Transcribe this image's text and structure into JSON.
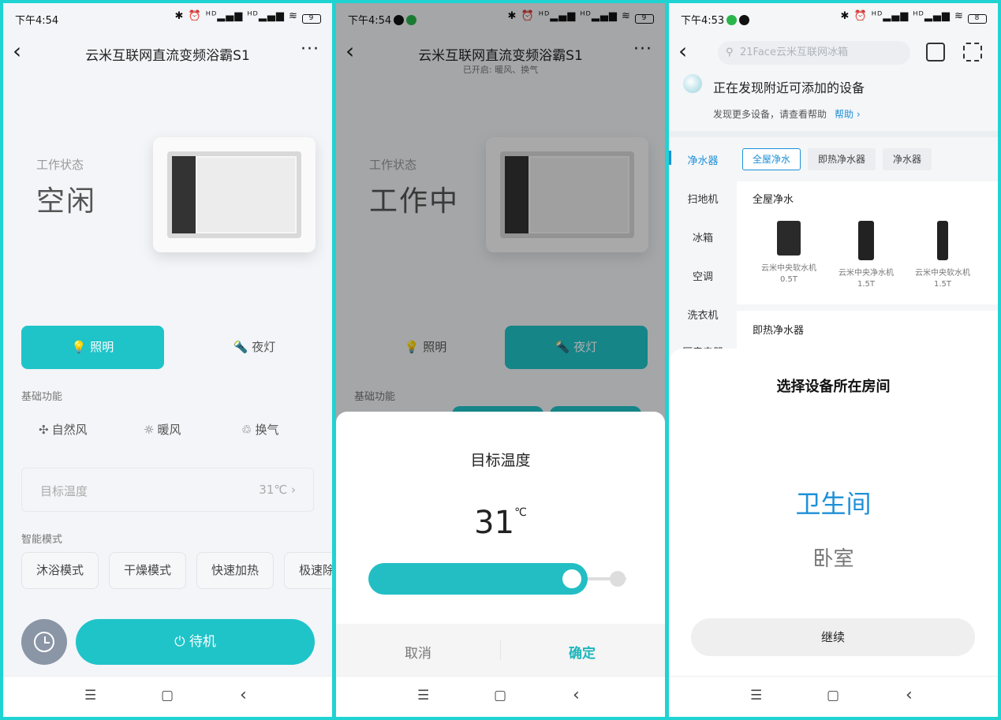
{
  "screen1": {
    "status": {
      "time": "下午4:54",
      "right": "✱ ⏰ ᴴᴰ▂▄▆ ᴴᴰ▂▄▆ ≋",
      "battery": "9"
    },
    "nav": {
      "title": "云米互联网直流变频浴霸S1",
      "more": "···"
    },
    "work_state_label": "工作状态",
    "work_state_value": "空闲",
    "tabs": [
      {
        "label": "照明",
        "active": true
      },
      {
        "label": "夜灯",
        "active": false
      }
    ],
    "basic_label": "基础功能",
    "functions": [
      "自然风",
      "暖风",
      "换气"
    ],
    "target_temp": {
      "label": "目标温度",
      "value": "31℃"
    },
    "smart_label": "智能模式",
    "modes": [
      "沐浴模式",
      "干燥模式",
      "快速加热",
      "极速除"
    ],
    "standby_label": "待机"
  },
  "screen2": {
    "status": {
      "time": "下午4:54",
      "right": "✱ ⏰ ᴴᴰ▂▄▆ ᴴᴰ▂▄▆ ≋",
      "battery": "9"
    },
    "nav": {
      "title": "云米互联网直流变频浴霸S1",
      "subtitle": "已开启: 暖风、换气",
      "more": "···"
    },
    "work_state_label": "工作状态",
    "work_state_value": "工作中",
    "tabs": [
      {
        "label": "照明",
        "active": false
      },
      {
        "label": "夜灯",
        "active": true
      }
    ],
    "basic_label": "基础功能",
    "sheet": {
      "title": "目标温度",
      "value": "31",
      "unit": "℃",
      "slider_fraction": 0.79,
      "cancel": "取消",
      "confirm": "确定"
    }
  },
  "screen3": {
    "status": {
      "time": "下午4:53",
      "right": "✱ ⏰ ᴴᴰ▂▄▆ ᴴᴰ▂▄▆ ≋",
      "battery": "8"
    },
    "search_placeholder": "21Face云米互联网冰箱",
    "discover_title": "正在发现附近可添加的设备",
    "help_text": "发现更多设备，请查看帮助",
    "help_link": "帮助 ›",
    "categories": [
      "净水器",
      "扫地机",
      "冰箱",
      "空调",
      "洗衣机",
      "厨房电器"
    ],
    "chips": [
      "全屋净水",
      "即热净水器",
      "净水器"
    ],
    "panel1_title": "全屋净水",
    "products": [
      "云米中央软水机0.5T",
      "云米中央净水机1.5T",
      "云米中央软水机1.5T"
    ],
    "panel2_title": "即热净水器",
    "room_sheet": {
      "title": "选择设备所在房间",
      "selected": "卫生间",
      "option": "卧室",
      "continue": "继续"
    }
  },
  "colors": {
    "accent": "#1fc4c9",
    "link": "#1e90d8",
    "border": "#1fd3d3"
  },
  "navbar": {
    "menu": "☰",
    "home": "▢",
    "back": "‹"
  }
}
